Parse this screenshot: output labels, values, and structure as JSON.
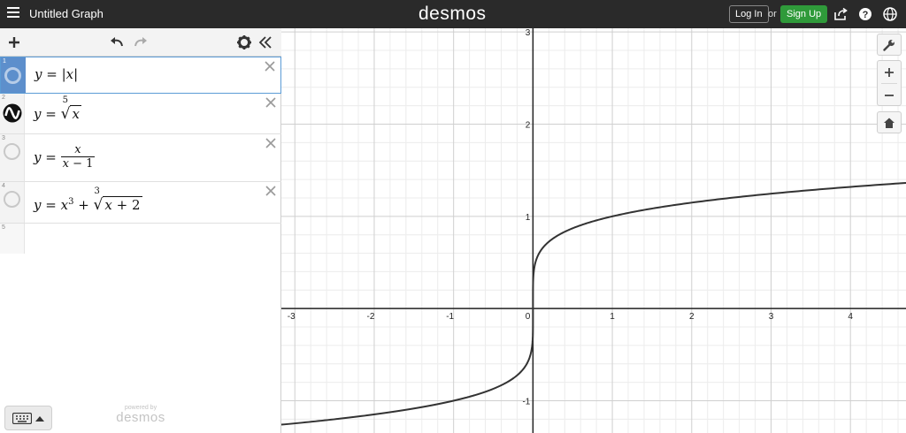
{
  "header": {
    "title": "Untitled Graph",
    "brand": "desmos",
    "login_label": "Log In",
    "or_text": "or",
    "signup_label": "Sign Up",
    "icons": [
      "menu-icon",
      "share-icon",
      "help-icon",
      "language-icon"
    ]
  },
  "expression_panel": {
    "toolbar_icons": [
      "add-icon",
      "undo-icon",
      "redo-icon",
      "settings-icon",
      "collapse-icon"
    ],
    "expressions": [
      {
        "index": "1",
        "formula": "y = |x|",
        "active": true
      },
      {
        "index": "2",
        "formula": "y = ⁵√x",
        "active": false,
        "visible": true
      },
      {
        "index": "3",
        "formula": "y = x/(x − 1)",
        "active": false
      },
      {
        "index": "4",
        "formula": "y = x³ + ³√(x + 2)",
        "active": false
      },
      {
        "index": "5",
        "formula": "",
        "active": false
      }
    ],
    "powered_by": "powered by",
    "powered_brand": "desmos"
  },
  "graph": {
    "x_ticks": [
      "-3",
      "-2",
      "-1",
      "0",
      "1",
      "2",
      "3",
      "4"
    ],
    "y_ticks": [
      "3",
      "2",
      "1",
      "-1"
    ],
    "curve_color": "#333333",
    "grid_minor_color": "#ececec",
    "grid_major_color": "#cfcfcf",
    "side_buttons": [
      "wrench-icon",
      "zoom-in-icon",
      "zoom-out-icon",
      "home-icon"
    ]
  },
  "chart_data": {
    "type": "line",
    "series": [
      {
        "name": "y = ⁵√x",
        "function": "fifth_root"
      }
    ],
    "xlim": [
      -3.17,
      4.7
    ],
    "ylim": [
      -1.35,
      3.04
    ],
    "grid": true
  }
}
